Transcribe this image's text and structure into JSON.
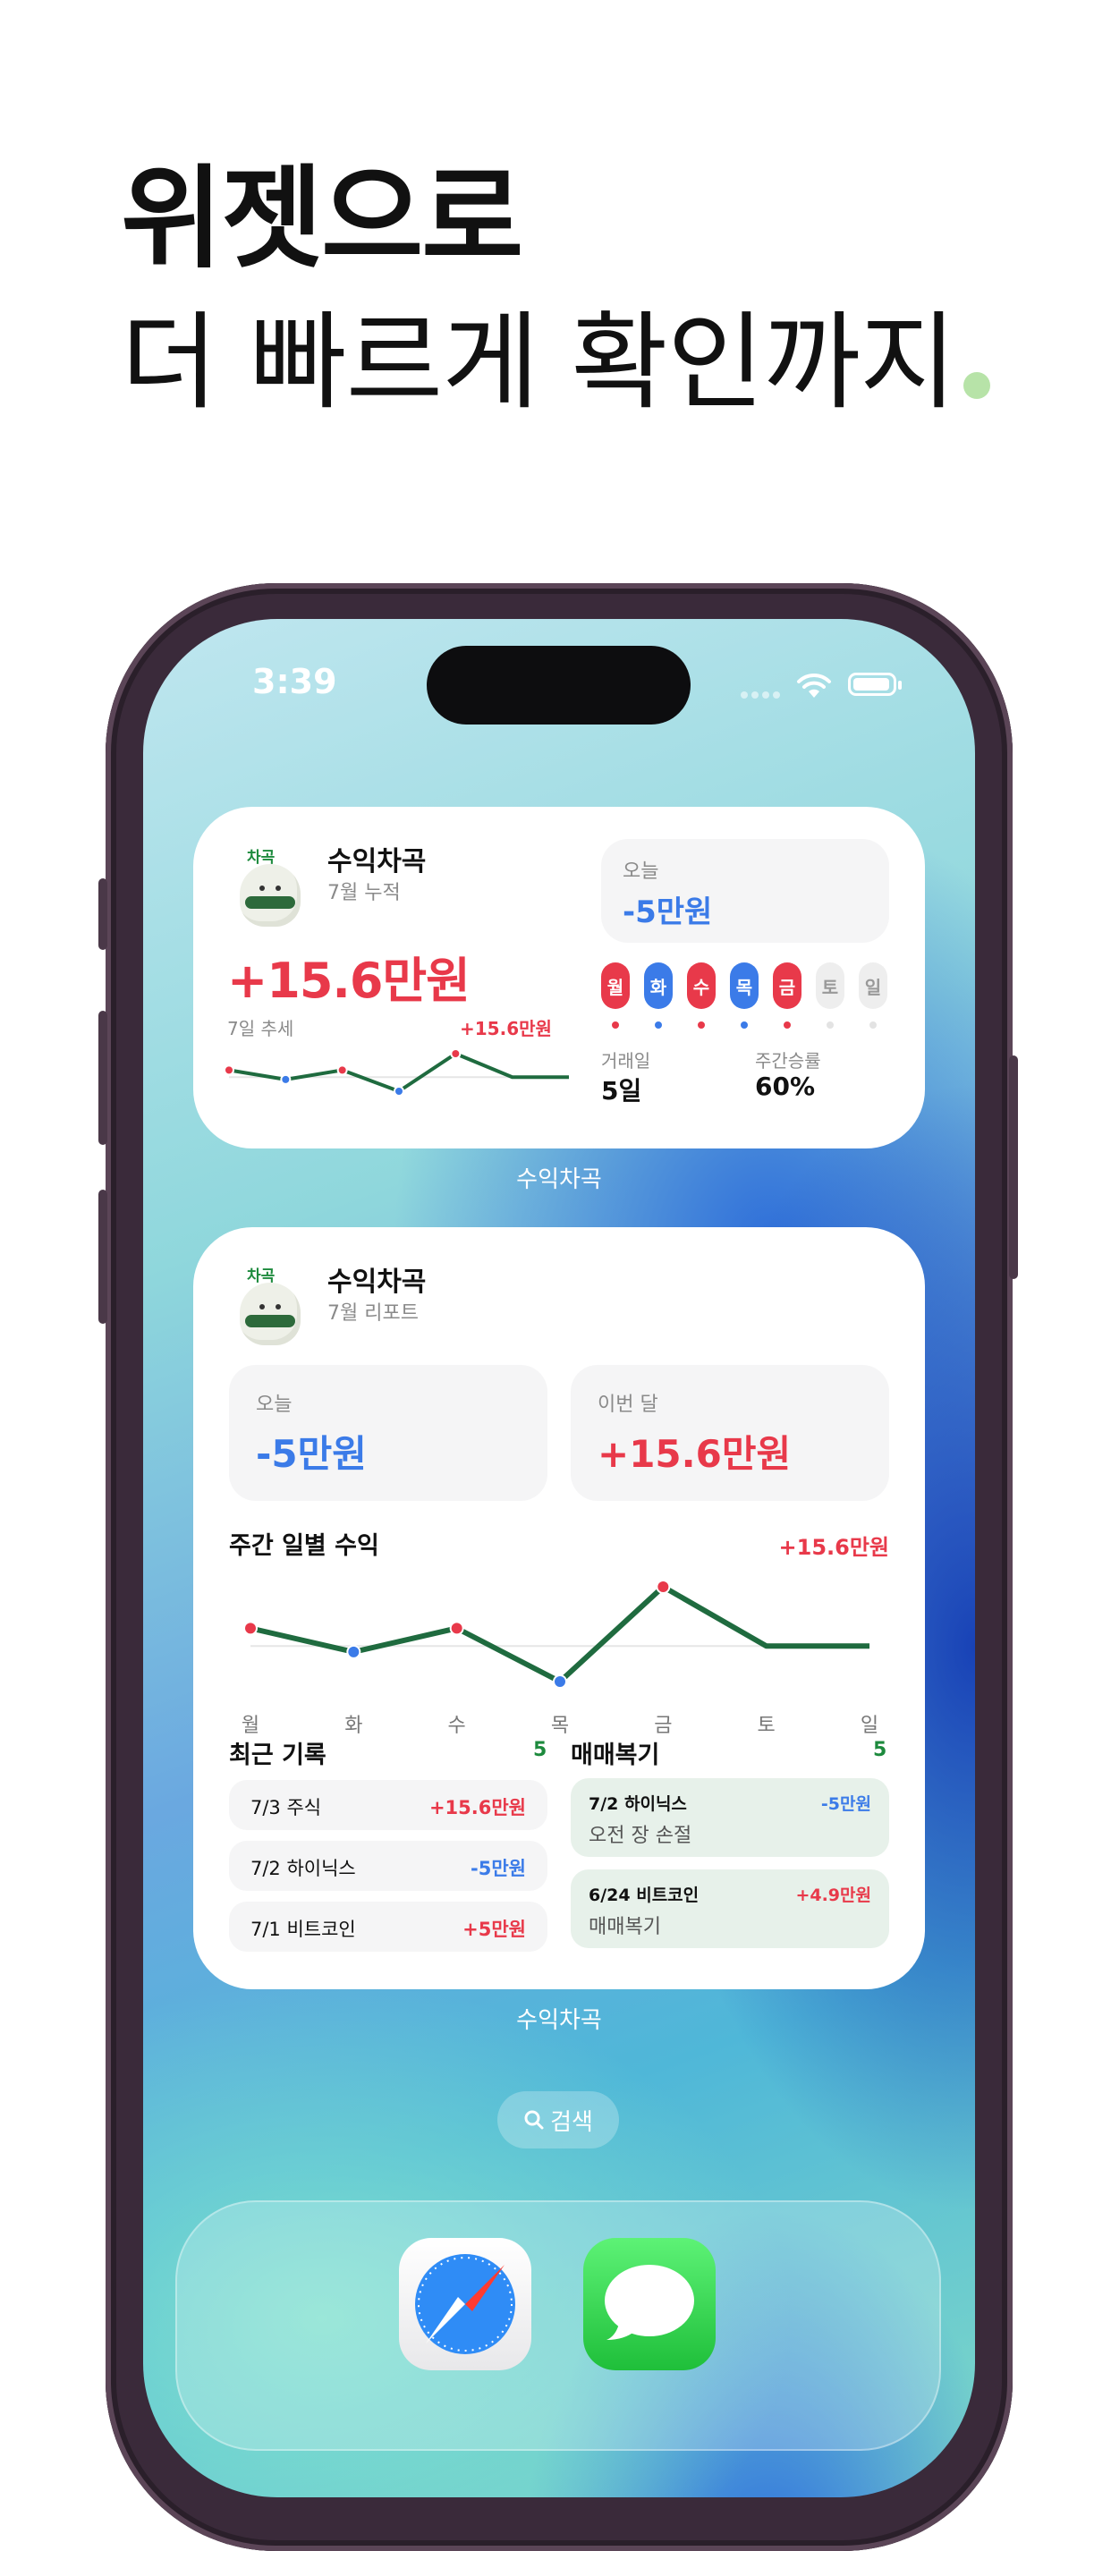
{
  "headline": {
    "line1": "위젯으로",
    "line2": "더 빠르게 확인까지"
  },
  "status": {
    "time": "3:39"
  },
  "widget_small": {
    "app_name": "수익차곡",
    "subtitle": "7월 누적",
    "mascot_tag": "차곡",
    "amount": "+15.6만원",
    "trend_label": "7일 추세",
    "trend_value": "+15.6만원",
    "today_label": "오늘",
    "today_value": "-5만원",
    "days": [
      {
        "label": "월",
        "status": "up"
      },
      {
        "label": "화",
        "status": "down"
      },
      {
        "label": "수",
        "status": "up"
      },
      {
        "label": "목",
        "status": "down"
      },
      {
        "label": "금",
        "status": "up"
      },
      {
        "label": "토",
        "status": "none"
      },
      {
        "label": "일",
        "status": "none"
      }
    ],
    "stats": [
      {
        "label": "거래일",
        "value": "5일"
      },
      {
        "label": "주간승률",
        "value": "60%"
      }
    ],
    "home_label": "수익차곡"
  },
  "widget_large": {
    "app_name": "수익차곡",
    "subtitle": "7월 리포트",
    "mascot_tag": "차곡",
    "today_label": "오늘",
    "today_value": "-5만원",
    "month_label": "이번 달",
    "month_value": "+15.6만원",
    "weekly_title": "주간 일별 수익",
    "weekly_total": "+15.6만원",
    "recent_title": "최근 기록",
    "recent_count": "5",
    "recent": [
      {
        "label": "7/3 주식",
        "value": "+15.6만원",
        "dir": "up"
      },
      {
        "label": "7/2 하이닉스",
        "value": "-5만원",
        "dir": "down"
      },
      {
        "label": "7/1 비트코인",
        "value": "+5만원",
        "dir": "up"
      }
    ],
    "review_title": "매매복기",
    "review_count": "5",
    "reviews": [
      {
        "label": "7/2 하이닉스",
        "value": "-5만원",
        "dir": "down",
        "note": "오전 장 손절"
      },
      {
        "label": "6/24 비트코인",
        "value": "+4.9만원",
        "dir": "up",
        "note": "매매복기"
      }
    ],
    "home_label": "수익차곡"
  },
  "search": {
    "label": "검색"
  },
  "dock": {
    "apps": [
      "safari-icon",
      "messages-icon"
    ]
  },
  "colors": {
    "up": "#e8394a",
    "down": "#3b7be8",
    "line": "#1f6b3f",
    "none": "#eeeeee"
  },
  "chart_data": {
    "type": "line",
    "categories": [
      "월",
      "화",
      "수",
      "목",
      "금",
      "토",
      "일"
    ],
    "series": [
      {
        "values": [
          1.5,
          -0.5,
          1.5,
          -3,
          5,
          0,
          0
        ]
      }
    ],
    "point_status": [
      "up",
      "down",
      "up",
      "down",
      "up",
      "none",
      "none"
    ],
    "title": "주간 일별 수익",
    "legend": false
  }
}
